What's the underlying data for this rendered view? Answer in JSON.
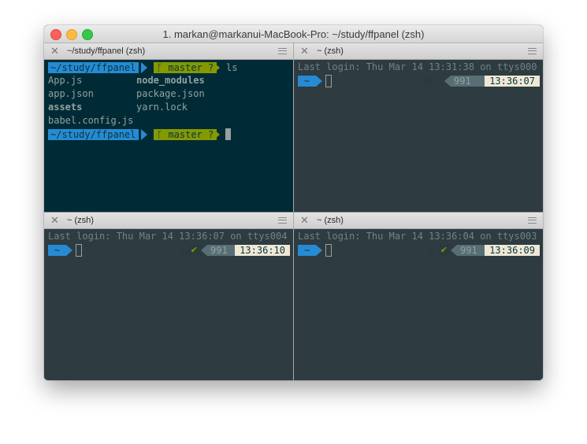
{
  "window": {
    "title": "1. markan@markanui-MacBook-Pro: ~/study/ffpanel (zsh)"
  },
  "colors": {
    "blue": "#268bd2",
    "green": "#859900",
    "active_bg": "#002b36",
    "inactive_bg": "#2e3b40",
    "time_bg": "#eee8d5"
  },
  "panes": {
    "top_left": {
      "tab_label": "~/study/ffpanel (zsh)",
      "prompt_path": "~/study/ffpanel",
      "branch_glyph": "ᚴ",
      "branch": "master ?",
      "command": "ls",
      "files": [
        [
          "App.js",
          "node_modules"
        ],
        [
          "app.json",
          "package.json"
        ],
        [
          "assets",
          "yarn.lock"
        ],
        [
          "babel.config.js",
          ""
        ]
      ],
      "prompt2_path": "~/study/ffpanel",
      "branch2": "master ?"
    },
    "top_right": {
      "tab_label": "~ (zsh)",
      "last_login": "Last login: Thu Mar 14 13:31:38 on ttys000",
      "prompt_path": "~",
      "hist": "991",
      "time": "13:36:07"
    },
    "bottom_left": {
      "tab_label": "~ (zsh)",
      "last_login": "Last login: Thu Mar 14 13:36:07 on ttys004",
      "prompt_path": "~",
      "ok": "✔",
      "hist": "991",
      "time": "13:36:10"
    },
    "bottom_right": {
      "tab_label": "~ (zsh)",
      "last_login": "Last login: Thu Mar 14 13:36:04 on ttys003",
      "prompt_path": "~",
      "ok": "✔",
      "hist": "991",
      "time": "13:36:09"
    }
  },
  "icons": {
    "close_tab": "close-icon",
    "pane_menu": "hamburger-icon"
  }
}
